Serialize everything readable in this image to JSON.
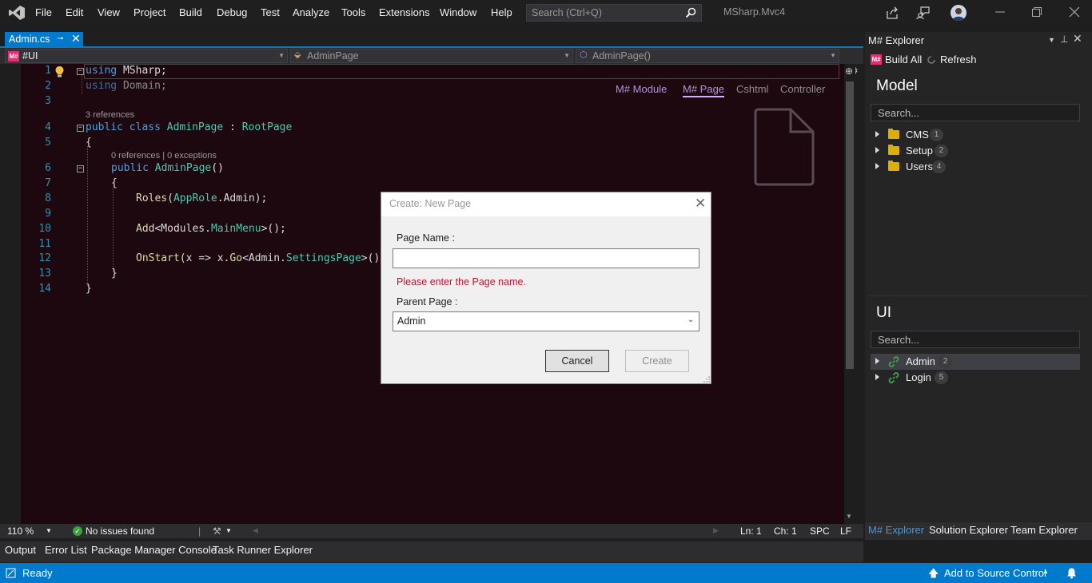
{
  "menubar": {
    "items": [
      "File",
      "Edit",
      "View",
      "Project",
      "Build",
      "Debug",
      "Test",
      "Analyze",
      "Tools",
      "Extensions",
      "Window",
      "Help"
    ],
    "search_placeholder": "Search (Ctrl+Q)",
    "solution_name": "MSharp.Mvc4"
  },
  "doc_tab": {
    "label": "Admin.cs"
  },
  "navbar": {
    "project": "#UI",
    "project_badge": "M#",
    "type": "AdminPage",
    "member": "AdminPage()"
  },
  "editor": {
    "line_numbers": [
      "1",
      "2",
      "3",
      "4",
      "5",
      "6",
      "7",
      "8",
      "9",
      "10",
      "11",
      "12",
      "13",
      "14"
    ],
    "codelens_class": "3 references",
    "codelens_ctor": "0 references | 0 exceptions",
    "view_tabs": [
      "M# Module",
      "M# Page",
      "Cshtml",
      "Controller"
    ],
    "active_view_tab": "M# Page"
  },
  "editor_status": {
    "zoom": "110 %",
    "issues": "No issues found",
    "line": "Ln: 1",
    "char": "Ch: 1",
    "whitespace": "SPC",
    "line_ending": "LF"
  },
  "bottom_tabs": [
    "Output",
    "Error List",
    "Package Manager Console",
    "Task Runner Explorer"
  ],
  "statusbar": {
    "ready": "Ready",
    "source_control": "Add to Source Control"
  },
  "explorer": {
    "title": "M# Explorer",
    "build_all": "Build All",
    "refresh": "Refresh",
    "badge": "M#",
    "model": {
      "title": "Model",
      "search_placeholder": "Search...",
      "items": [
        {
          "label": "CMS",
          "count": "1"
        },
        {
          "label": "Setup",
          "count": "2"
        },
        {
          "label": "Users",
          "count": "4"
        }
      ]
    },
    "ui": {
      "title": "UI",
      "search_placeholder": "Search...",
      "items": [
        {
          "label": "Admin",
          "count": "2"
        },
        {
          "label": "Login",
          "count": "5"
        }
      ]
    },
    "tabs": [
      "M# Explorer",
      "Solution Explorer",
      "Team Explorer"
    ]
  },
  "dialog": {
    "title": "Create: New Page",
    "page_name_label": "Page Name :",
    "page_name_value": "",
    "error": "Please enter the Page name.",
    "parent_label": "Parent Page :",
    "parent_value": "Admin",
    "cancel": "Cancel",
    "create": "Create"
  },
  "colors": {
    "accent": "#007acc",
    "editor_bg": "#1e0810",
    "error": "#c4122f",
    "active_view_tab": "#b48ee5"
  }
}
